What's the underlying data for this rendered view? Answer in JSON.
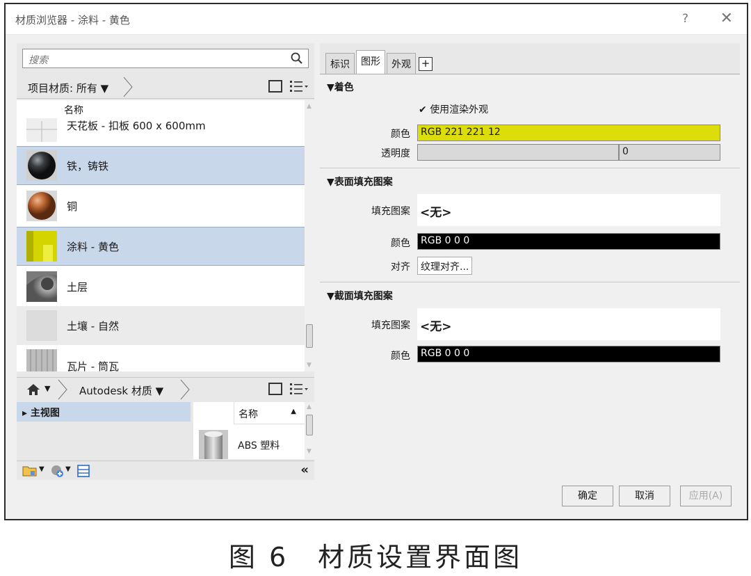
{
  "window": {
    "title": "材质浏览器 - 涂料 - 黄色",
    "help": "?",
    "close": "✕"
  },
  "search": {
    "placeholder": "搜索"
  },
  "project": {
    "breadcrumb": "项目材质: 所有 ▼",
    "column_header": "名称",
    "items": [
      {
        "label": "天花板 - 扣板 600 x 600mm",
        "thumb": "ceiling-tile",
        "selected": false
      },
      {
        "label": "铁，铸铁",
        "thumb": "dark-sphere",
        "selected": true
      },
      {
        "label": "铜",
        "thumb": "copper-sphere",
        "selected": false
      },
      {
        "label": "涂料 - 黄色",
        "thumb": "yellow-paint",
        "selected": true
      },
      {
        "label": "土层",
        "thumb": "gray-soil",
        "selected": false
      },
      {
        "label": "土壤 - 自然",
        "thumb": "natural-soil",
        "selected": false
      },
      {
        "label": "瓦片 - 筒瓦",
        "thumb": "tile",
        "selected": false
      }
    ]
  },
  "library": {
    "breadcrumb": "Autodesk 材质 ▼",
    "tree_node": "▸ 主视图",
    "column_header": "名称",
    "items": [
      "ABS 塑料"
    ]
  },
  "tabs": [
    "标识",
    "图形",
    "外观"
  ],
  "active_tab": "图形",
  "shading": {
    "title": "▼着色",
    "use_render_label": "使用渲染外观",
    "use_render_checked": true,
    "color_label": "颜色",
    "color_value": "RGB 221 221 12",
    "color_hex": "#dddd0c",
    "transparency_label": "透明度",
    "transparency_value": "0"
  },
  "surface": {
    "title": "▼表面填充图案",
    "pattern_label": "填充图案",
    "pattern_value": "<无>",
    "color_label": "颜色",
    "color_value": "RGB 0 0 0",
    "align_label": "对齐",
    "align_button": "纹理对齐..."
  },
  "cut": {
    "title": "▼截面填充图案",
    "pattern_label": "填充图案",
    "pattern_value": "<无>",
    "color_label": "颜色",
    "color_value": "RGB 0 0 0"
  },
  "footer": {
    "ok": "确定",
    "cancel": "取消",
    "apply": "应用(A)"
  },
  "caption": "图 6　材质设置界面图"
}
